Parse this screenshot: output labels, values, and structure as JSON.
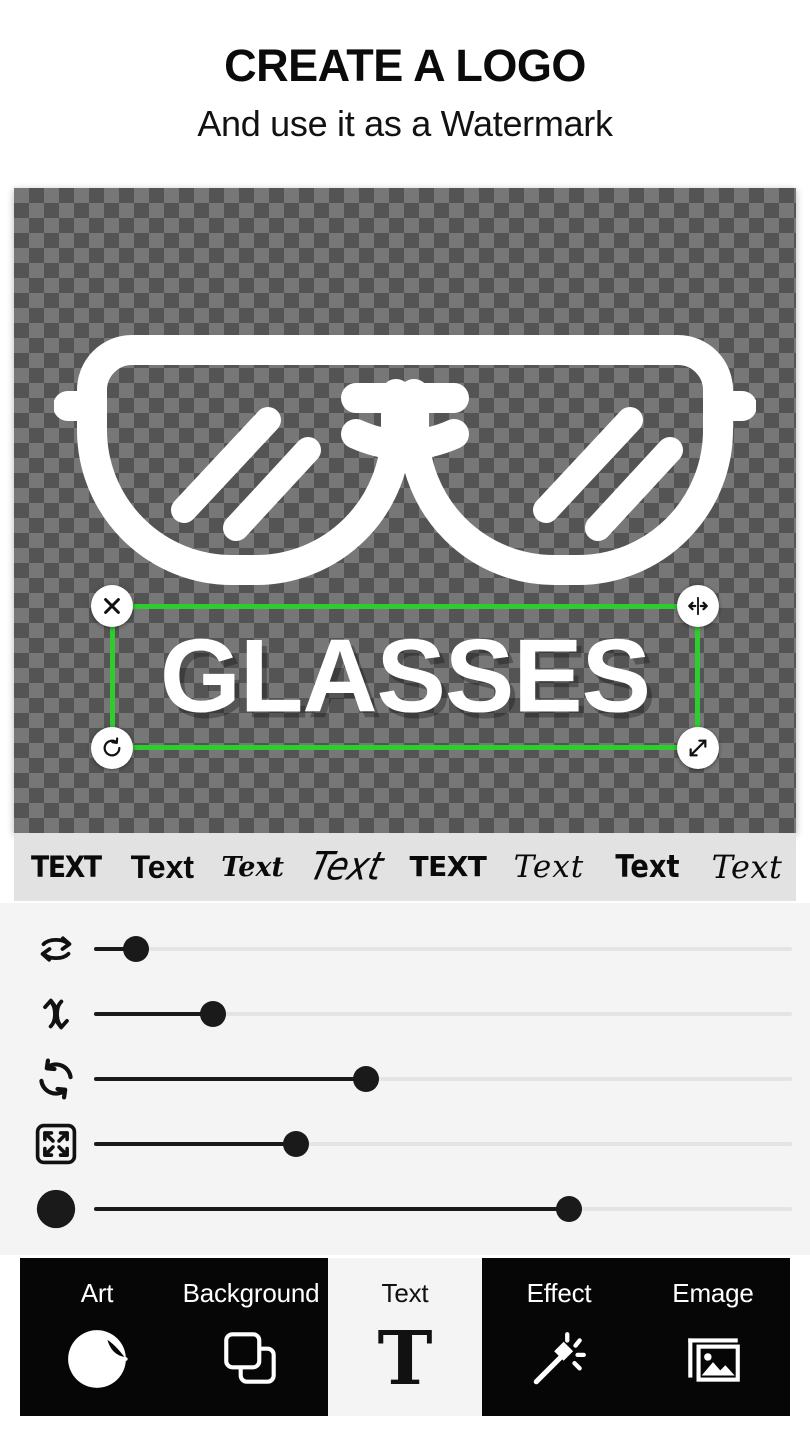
{
  "header": {
    "headline": "CREATE A LOGO",
    "subhead": "And use it as a Watermark"
  },
  "canvas": {
    "logo_text": "GLASSES",
    "artwork_icon": "glasses-icon",
    "background": "transparent-checkerboard",
    "checker_colors": [
      "#545454",
      "#777777"
    ],
    "selection": {
      "border_color": "#2ECC2E",
      "handles": [
        {
          "position": "top-left",
          "icon": "close-icon",
          "glyph": "×"
        },
        {
          "position": "top-right",
          "icon": "flip-horizontal-icon",
          "glyph": "↔"
        },
        {
          "position": "bottom-left",
          "icon": "rotate-reset-icon",
          "glyph": "↺"
        },
        {
          "position": "bottom-right",
          "icon": "resize-diagonal-icon",
          "glyph": "⤡"
        }
      ]
    }
  },
  "font_strip": {
    "items": [
      {
        "label": "TEXT",
        "style": "condensed-bold"
      },
      {
        "label": "Text",
        "style": "sans-bold"
      },
      {
        "label": "Text",
        "style": "serif-italic"
      },
      {
        "label": "Text",
        "style": "brush-script"
      },
      {
        "label": "TEXT",
        "style": "heavy-display"
      },
      {
        "label": "Text",
        "style": "calligraphy-thin"
      },
      {
        "label": "Text",
        "style": "slab-bold"
      },
      {
        "label": "Text",
        "style": "cursive-script"
      }
    ]
  },
  "sliders": [
    {
      "name": "flip-horizontal",
      "icon": "flip-horizontal-icon",
      "value": 6
    },
    {
      "name": "flip-vertical",
      "icon": "flip-vertical-icon",
      "value": 17
    },
    {
      "name": "rotate",
      "icon": "rotate-icon",
      "value": 39
    },
    {
      "name": "size",
      "icon": "expand-icon",
      "value": 29
    },
    {
      "name": "opacity",
      "icon": "opacity-circle-icon",
      "value": 68
    }
  ],
  "toolbar": {
    "items": [
      {
        "label": "Art",
        "icon": "sticker-icon",
        "active": false
      },
      {
        "label": "Background",
        "icon": "layers-icon",
        "active": false
      },
      {
        "label": "Text",
        "icon": "text-T-icon",
        "active": true
      },
      {
        "label": "Effect",
        "icon": "magic-wand-icon",
        "active": false
      },
      {
        "label": "Emage",
        "icon": "image-icon",
        "active": false
      }
    ]
  },
  "colors": {
    "accent_green": "#2ECC2E",
    "toolbar_bg": "#060606",
    "panel_bg": "#f4f4f4",
    "font_strip_bg": "#e2e2e2"
  }
}
